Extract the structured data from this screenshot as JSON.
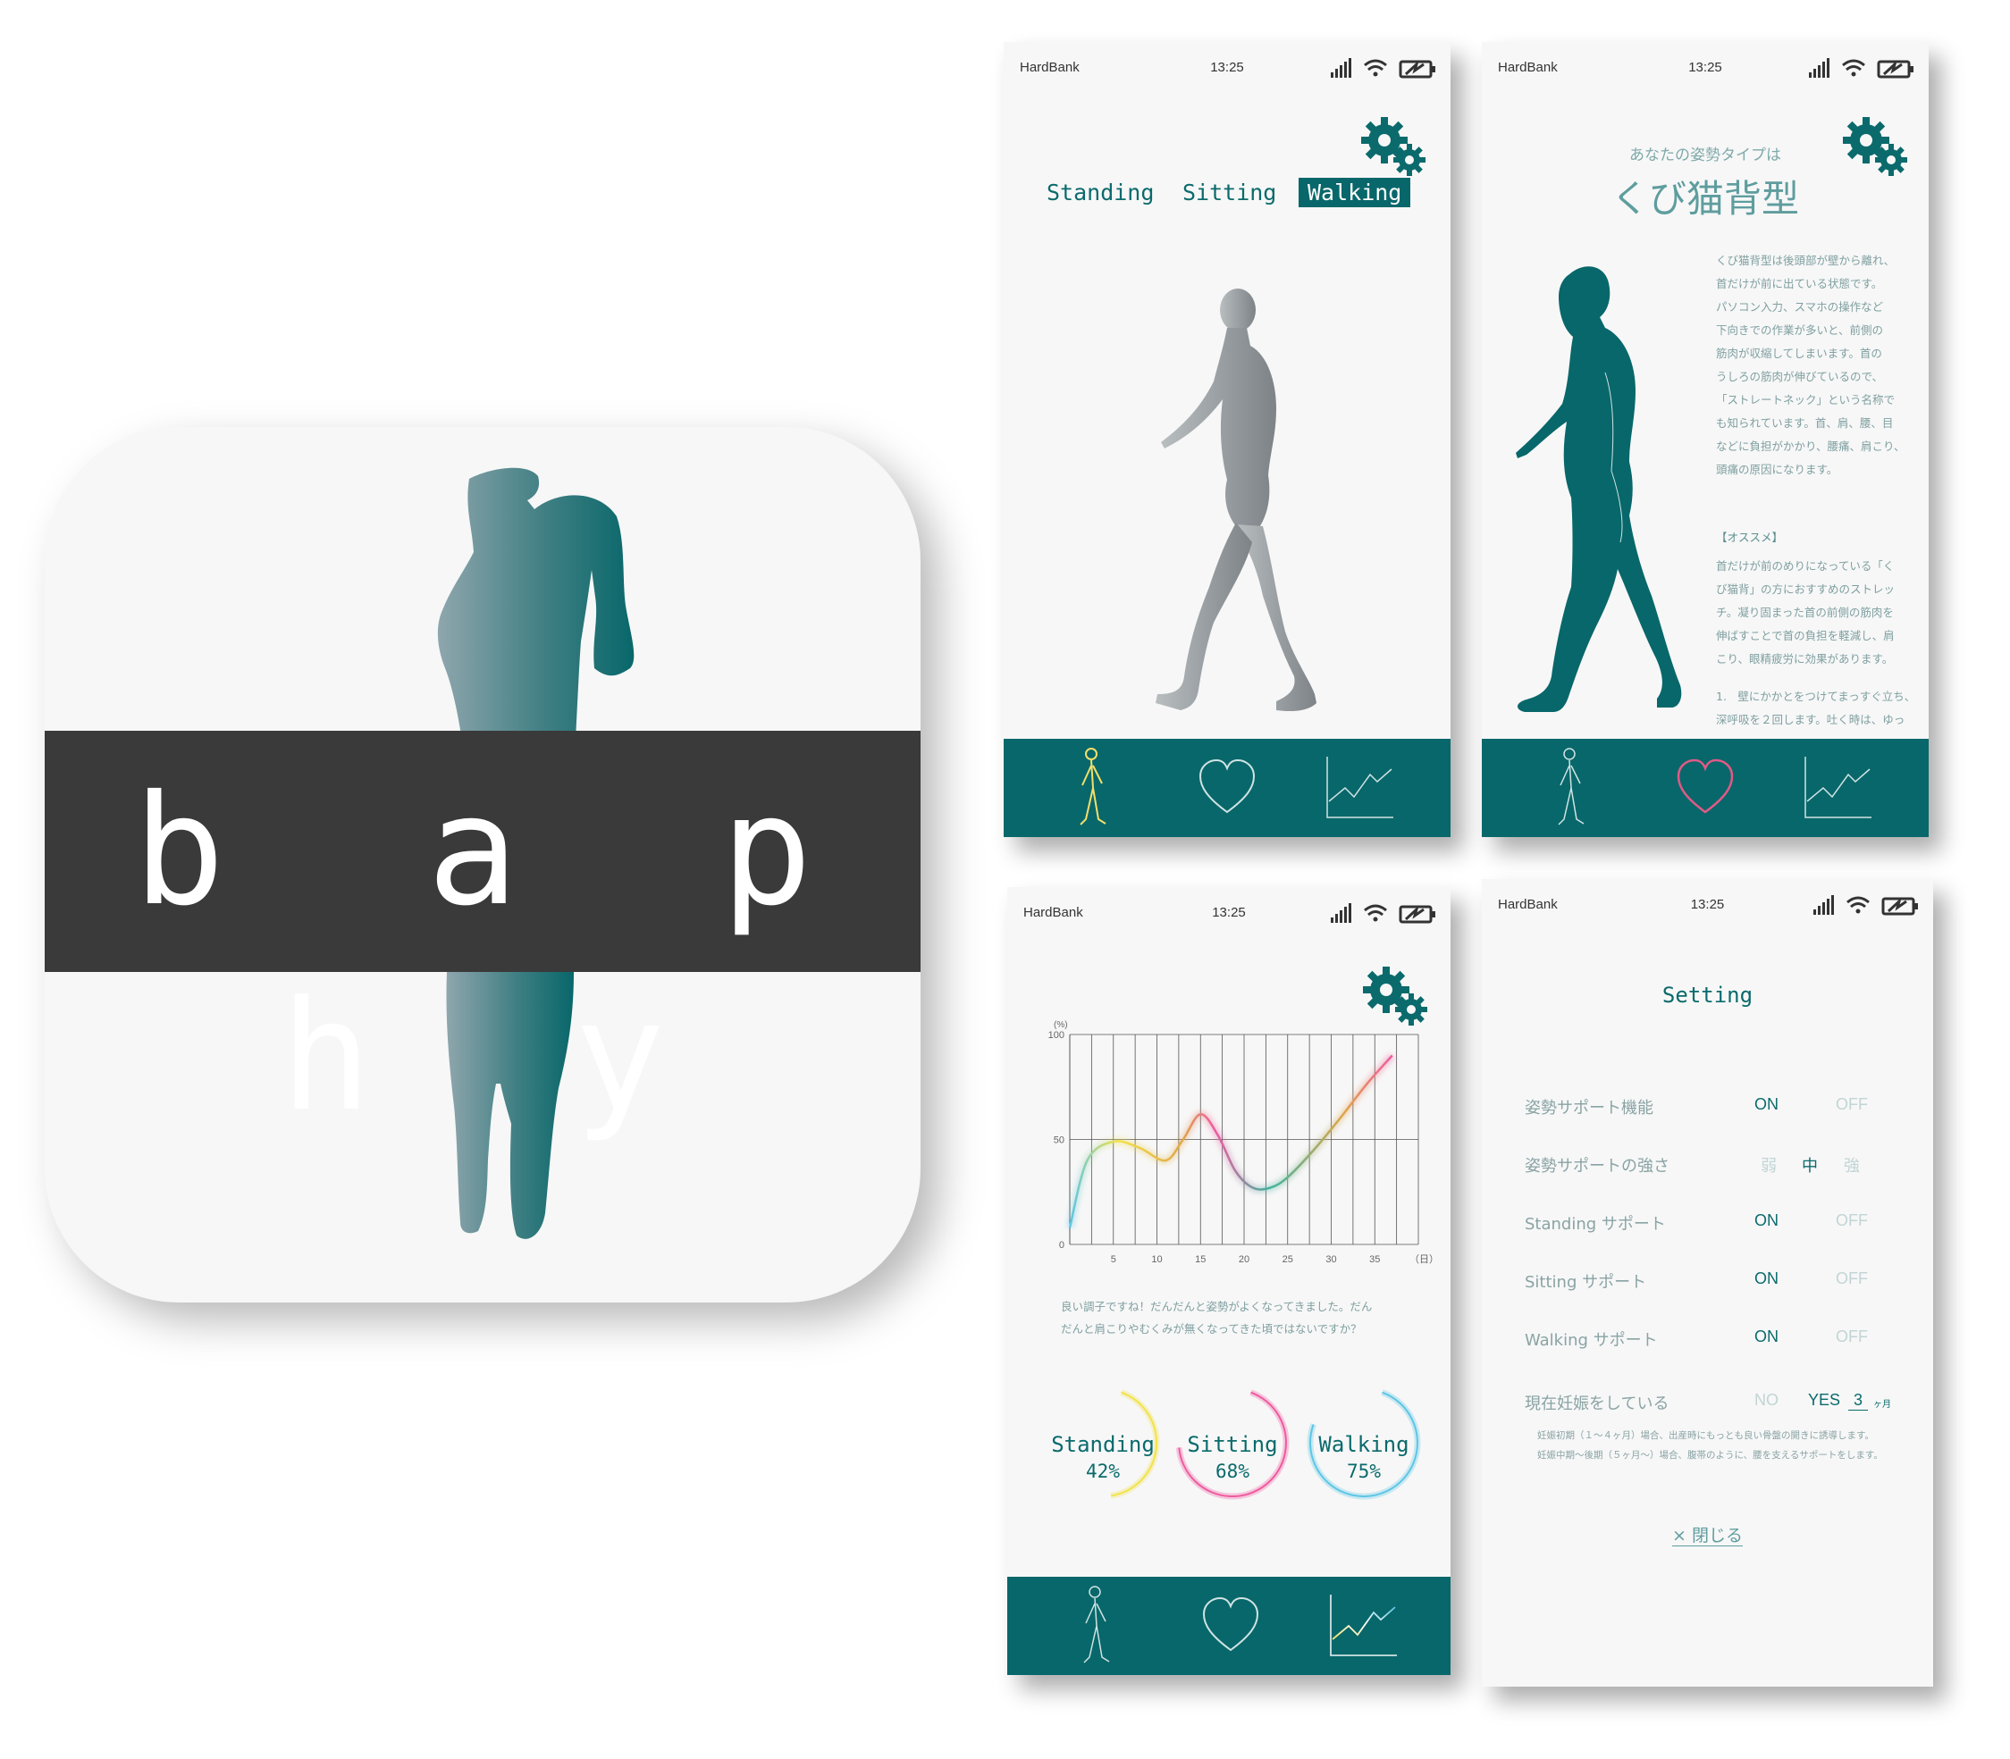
{
  "app": {
    "name": "b a p h y"
  },
  "status_bar": {
    "carrier": "HardBank",
    "time": "13:25"
  },
  "screen_posture": {
    "tabs": [
      {
        "label": "Standing",
        "active": false
      },
      {
        "label": "Sitting",
        "active": false
      },
      {
        "label": "Walking",
        "active": true
      }
    ]
  },
  "screen_type": {
    "subtitle": "あなたの姿勢タイプは",
    "title": "くび猫背型",
    "description": [
      "くび猫背型は後頭部が壁から離れ、",
      "首だけが前に出ている状態です。",
      "パソコン入力、スマホの操作など",
      "下向きでの作業が多いと、前側の",
      "筋肉が収縮してしまいます。首の",
      "うしろの筋肉が伸びているので、",
      "「ストレートネック」という名称で",
      "も知られています。首、肩、腰、目",
      "などに負担がかかり、腰痛、肩こり、",
      "頭痛の原因になります。"
    ],
    "recommend_heading": "【オススメ】",
    "recommend_text": [
      "首だけが前のめりになっている「く",
      "び猫背」の方におすすめのストレッ",
      "チ。凝り固まった首の前側の筋肉を",
      "伸ばすことで首の負担を軽減し、肩",
      "こり、眼精疲労に効果があります。"
    ],
    "step_text": [
      "1.　壁にかかとをつけてまっすぐ立ち、",
      "深呼吸を２回します。吐く時は、ゆっ"
    ]
  },
  "screen_stats": {
    "message": [
      "良い調子ですね！だんだんと姿勢がよくなってきました。だん",
      "だんと肩こりやむくみが無くなってきた頃ではないですか？"
    ],
    "rings": [
      {
        "name": "Standing",
        "value": "42%",
        "fraction": 0.42,
        "color": "#f2e24a"
      },
      {
        "name": "Sitting",
        "value": "68%",
        "fraction": 0.68,
        "color": "#ef5aa0"
      },
      {
        "name": "Walking",
        "value": "75%",
        "fraction": 0.75,
        "color": "#5cc6e6"
      }
    ]
  },
  "chart_data": {
    "type": "line",
    "xlabel": "（日）",
    "ylabel": "(%)",
    "ylim": [
      0,
      100
    ],
    "xlim": [
      0,
      40
    ],
    "xticks": [
      "5",
      "10",
      "15",
      "20",
      "25",
      "30",
      "35"
    ],
    "yticks": [
      "0",
      "50",
      "100"
    ],
    "grid": true,
    "series": [
      {
        "x": [
          0,
          2,
          5,
          8,
          11,
          13,
          15,
          17,
          19,
          21,
          23,
          25,
          28,
          31,
          34,
          37
        ],
        "y": [
          8,
          40,
          49,
          46,
          40,
          50,
          62,
          52,
          35,
          27,
          27,
          32,
          45,
          60,
          76,
          90
        ]
      }
    ]
  },
  "screen_settings": {
    "title": "Setting",
    "rows": [
      {
        "label": "姿勢サポート機能",
        "options": [
          "ON",
          "OFF"
        ],
        "selected": 0
      },
      {
        "label": "姿勢サポートの強さ",
        "options": [
          "弱",
          "中",
          "強"
        ],
        "selected": 1
      },
      {
        "label": "Standing サポート",
        "options": [
          "ON",
          "OFF"
        ],
        "selected": 0
      },
      {
        "label": "Sitting サポート",
        "options": [
          "ON",
          "OFF"
        ],
        "selected": 0
      },
      {
        "label": "Walking サポート",
        "options": [
          "ON",
          "OFF"
        ],
        "selected": 0
      },
      {
        "label": "現在妊娠をしている",
        "options": [
          "NO",
          "YES"
        ],
        "selected": 1,
        "months": "3",
        "unit": "ヶ月"
      }
    ],
    "notes": [
      "妊娠初期（１〜４ヶ月）場合、出産時にもっとも良い骨盤の開きに誘導します。",
      "妊娠中期〜後期（５ヶ月〜）場合、腹帯のように、腰を支えるサポートをします。"
    ],
    "close": "× 閉じる"
  },
  "colors": {
    "teal": "#08676a",
    "text_teal": "#0b6a6c",
    "icon_band": "#3a3a3a"
  }
}
